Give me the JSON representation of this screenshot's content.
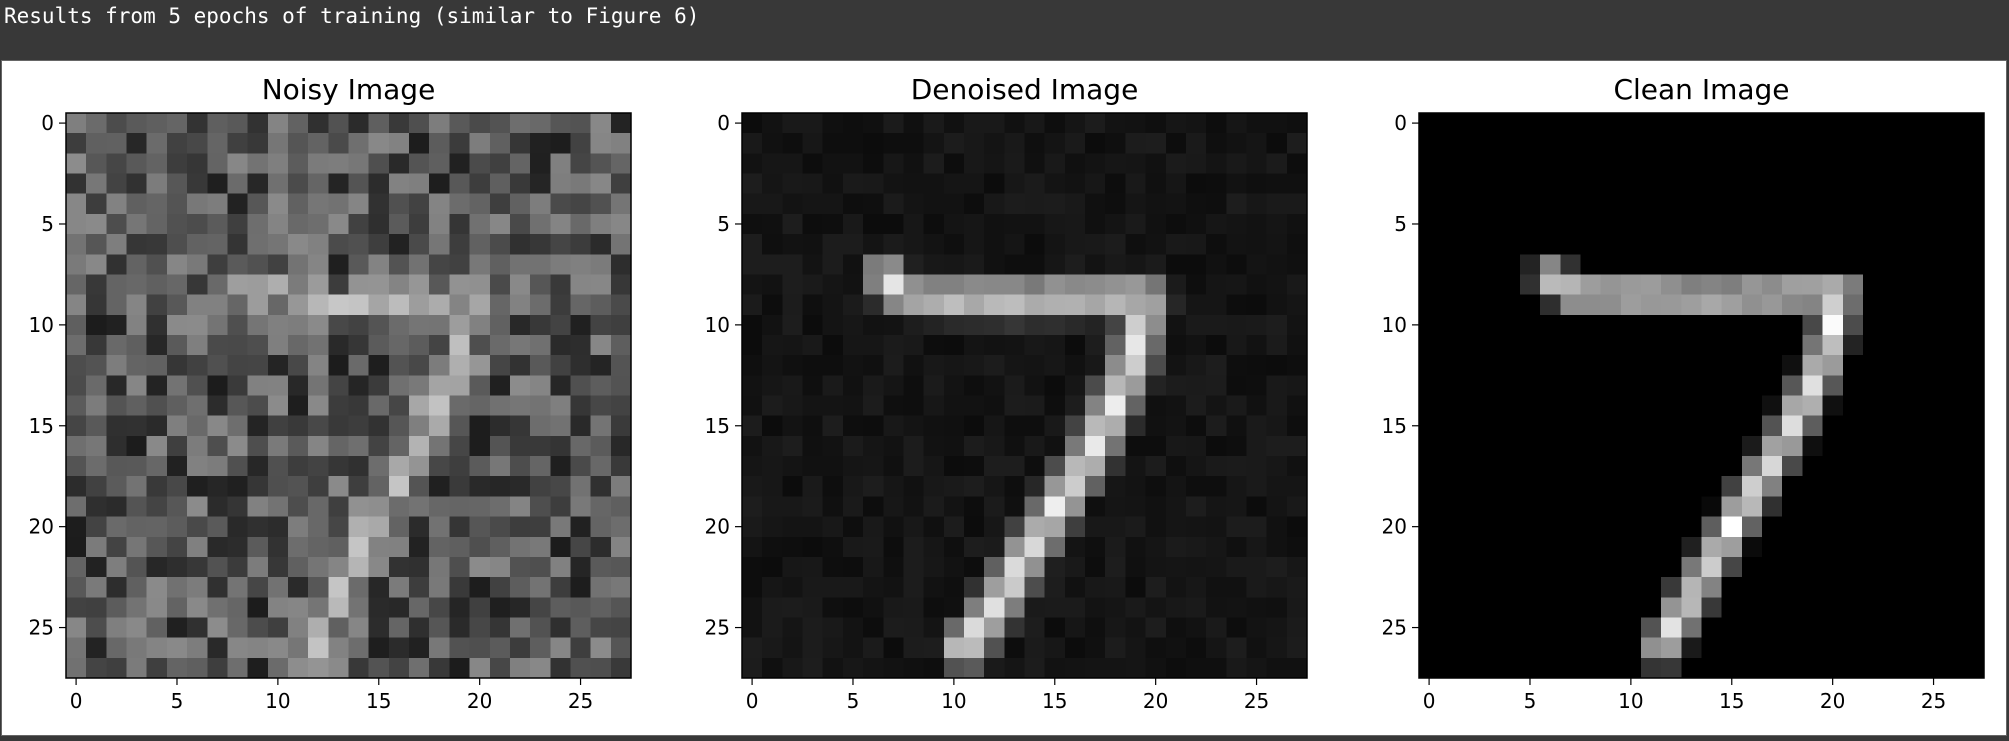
{
  "header_text": "Results from 5 epochs of training (similar to Figure 6)",
  "colors": {
    "page_background": "#383838",
    "figure_background": "#ffffff",
    "header_text": "#ffffff"
  },
  "colormap": "gray",
  "chart_data": [
    {
      "type": "heatmap",
      "title": "Noisy Image",
      "rows": 28,
      "cols": 28,
      "xlim": [
        -0.5,
        27.5
      ],
      "ylim": [
        27.5,
        -0.5
      ],
      "x_ticks": [
        0,
        5,
        10,
        15,
        20,
        25
      ],
      "y_ticks": [
        0,
        5,
        10,
        15,
        20,
        25
      ],
      "x_tick_labels": [
        "0",
        "5",
        "10",
        "15",
        "20",
        "25"
      ],
      "y_tick_labels": [
        "0",
        "5",
        "10",
        "15",
        "20",
        "25"
      ],
      "background_level": 0.33,
      "background_variation": 0.22,
      "stroke_level": 0.8,
      "stroke_weight": 0.55,
      "strokes": [
        {
          "points": [
            [
              8.0,
              7.8
            ],
            [
              11.5,
              8.9
            ],
            [
              17.5,
              8.9
            ],
            [
              19.5,
              8.5
            ]
          ],
          "width": 0.75,
          "peak": 1.0
        },
        {
          "points": [
            [
              19.6,
              9.2
            ],
            [
              18.5,
              13.0
            ],
            [
              16.5,
              17.0
            ],
            [
              14.0,
              21.0
            ],
            [
              12.0,
              25.0
            ],
            [
              11.8,
              26.0
            ]
          ],
          "width": 0.9,
          "peak": 1.0
        }
      ],
      "seed": 7
    },
    {
      "type": "heatmap",
      "title": "Denoised Image",
      "rows": 28,
      "cols": 28,
      "xlim": [
        -0.5,
        27.5
      ],
      "ylim": [
        27.5,
        -0.5
      ],
      "x_ticks": [
        0,
        5,
        10,
        15,
        20,
        25
      ],
      "y_ticks": [
        0,
        5,
        10,
        15,
        20,
        25
      ],
      "x_tick_labels": [
        "0",
        "5",
        "10",
        "15",
        "20",
        "25"
      ],
      "y_tick_labels": [
        "0",
        "5",
        "10",
        "15",
        "20",
        "25"
      ],
      "background_level": 0.08,
      "background_variation": 0.035,
      "stroke_level": 1.0,
      "stroke_weight": 1.0,
      "strokes": [
        {
          "points": [
            [
              6.5,
              7.5
            ],
            [
              7.5,
              8.6
            ],
            [
              14.0,
              8.7
            ],
            [
              19.5,
              8.6
            ]
          ],
          "width": 0.95,
          "peak": 0.95
        },
        {
          "points": [
            [
              19.5,
              8.8
            ],
            [
              18.8,
              12.0
            ],
            [
              17.0,
              16.0
            ],
            [
              14.5,
              20.0
            ],
            [
              12.0,
              24.0
            ],
            [
              10.5,
              26.0
            ]
          ],
          "width": 1.0,
          "peak": 1.0
        }
      ],
      "seed": 3
    },
    {
      "type": "heatmap",
      "title": "Clean Image",
      "rows": 28,
      "cols": 28,
      "xlim": [
        -0.5,
        27.5
      ],
      "ylim": [
        27.5,
        -0.5
      ],
      "x_ticks": [
        0,
        5,
        10,
        15,
        20,
        25
      ],
      "y_ticks": [
        0,
        5,
        10,
        15,
        20,
        25
      ],
      "x_tick_labels": [
        "0",
        "5",
        "10",
        "15",
        "20",
        "25"
      ],
      "y_tick_labels": [
        "0",
        "5",
        "10",
        "15",
        "20",
        "25"
      ],
      "background_level": 0.0,
      "background_variation": 0.0,
      "stroke_level": 1.0,
      "stroke_weight": 1.0,
      "strokes": [
        {
          "points": [
            [
              6.0,
              7.6
            ],
            [
              7.0,
              8.4
            ],
            [
              14.0,
              8.6
            ],
            [
              20.5,
              8.4
            ]
          ],
          "width": 0.85,
          "peak": 1.0
        },
        {
          "points": [
            [
              20.3,
              8.8
            ],
            [
              19.5,
              12.0
            ],
            [
              17.5,
              16.0
            ],
            [
              15.0,
              20.0
            ],
            [
              13.0,
              23.5
            ],
            [
              11.5,
              26.0
            ]
          ],
          "width": 0.9,
          "peak": 1.0
        }
      ],
      "seed": 1
    }
  ]
}
